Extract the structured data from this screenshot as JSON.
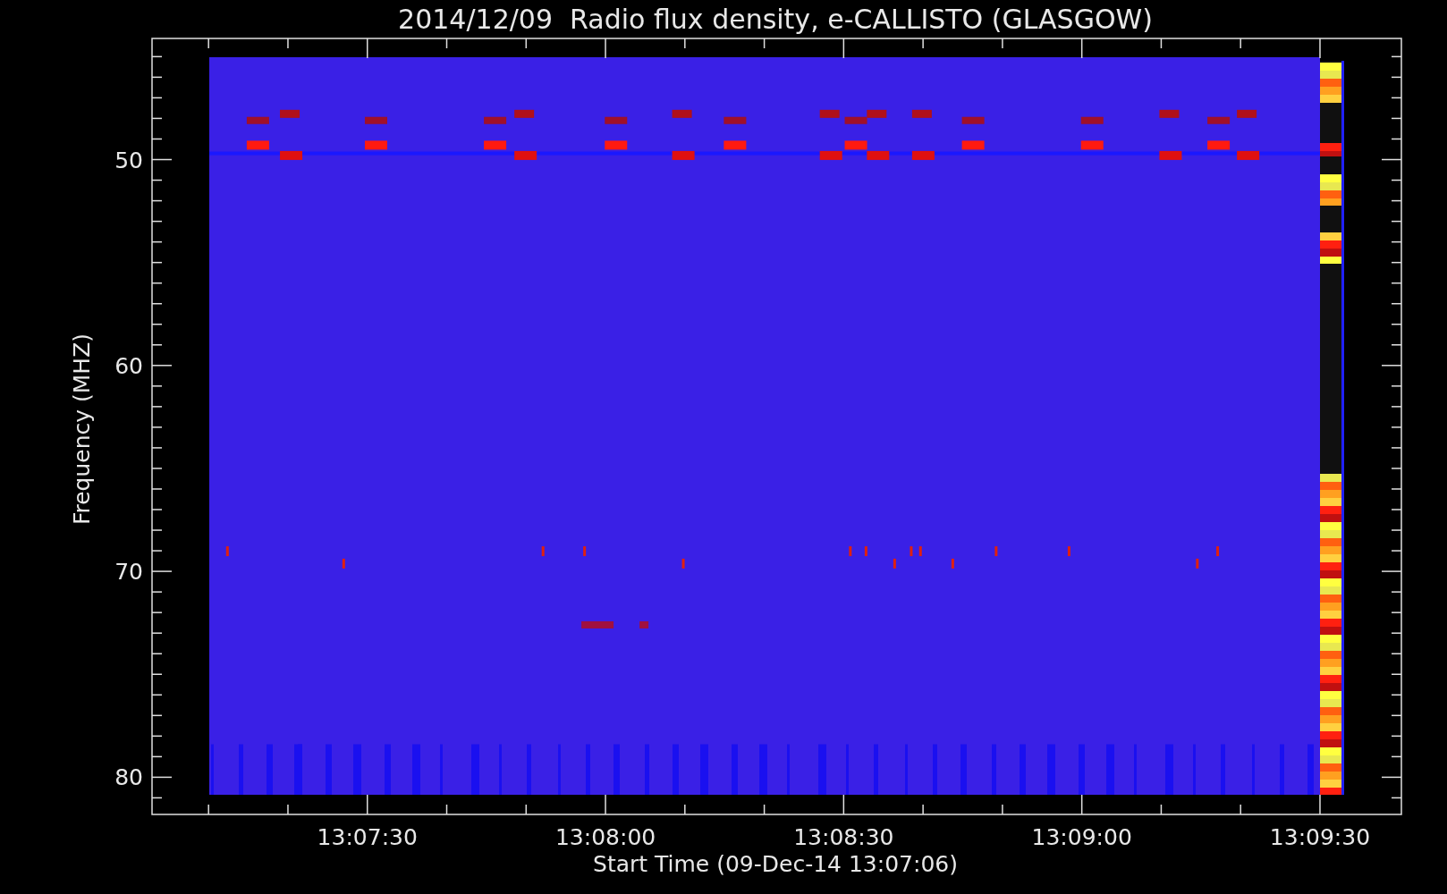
{
  "title": "2014/12/09  Radio flux density, e-CALLISTO (GLASGOW)",
  "y_axis": {
    "label": "Frequency (MHZ)",
    "ticks": [
      "50",
      "60",
      "70",
      "80"
    ]
  },
  "x_axis": {
    "label": "Start Time (09-Dec-14 13:07:06)",
    "ticks": [
      "13:07:30",
      "13:08:00",
      "13:08:30",
      "13:09:00",
      "13:09:30"
    ]
  }
}
